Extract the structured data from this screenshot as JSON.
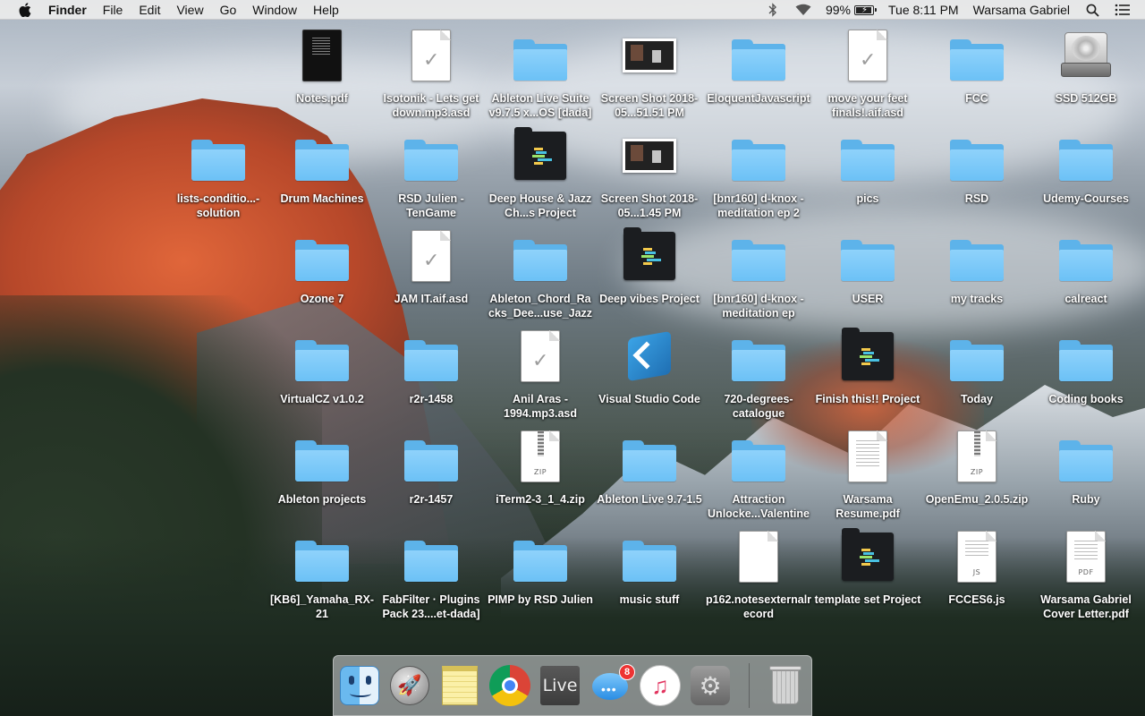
{
  "menubar": {
    "apple_icon": "apple-icon",
    "app_name": "Finder",
    "menus": [
      "File",
      "Edit",
      "View",
      "Go",
      "Window",
      "Help"
    ],
    "status": {
      "bluetooth_icon": "bluetooth-icon",
      "wifi_icon": "wifi-icon",
      "battery_percent": "99%",
      "battery_level": 0.99,
      "clock": "Tue 8:11 PM",
      "user": "Warsama Gabriel",
      "spotlight_icon": "search-icon",
      "notification_icon": "list-icon"
    }
  },
  "desktop": {
    "icons": [
      {
        "label": "Notes.pdf",
        "kind": "pdf-dark"
      },
      {
        "label": "Isotonik - Lets get down.mp3.asd",
        "kind": "doc-check"
      },
      {
        "label": "Ableton Live Suite v9.7.5 x...OS [dada]",
        "kind": "folder"
      },
      {
        "label": "Screen Shot 2018-05...51.51 PM",
        "kind": "screenshot"
      },
      {
        "label": "EloquentJavascript",
        "kind": "folder"
      },
      {
        "label": "move your feet finals!.aif.asd",
        "kind": "doc-check"
      },
      {
        "label": "FCC",
        "kind": "folder"
      },
      {
        "label": "SSD 512GB",
        "kind": "hdd"
      },
      {
        "label": "lists-conditio...-solution",
        "kind": "folder"
      },
      {
        "label": "Drum Machines",
        "kind": "folder"
      },
      {
        "label": "RSD Julien - TenGame",
        "kind": "folder"
      },
      {
        "label": "Deep House & Jazz Ch...s Project",
        "kind": "ableton"
      },
      {
        "label": "Screen Shot 2018-05...1.45 PM",
        "kind": "screenshot"
      },
      {
        "label": "[bnr160] d-knox - meditation ep 2",
        "kind": "folder"
      },
      {
        "label": "pics",
        "kind": "folder"
      },
      {
        "label": "RSD",
        "kind": "folder"
      },
      {
        "label": "Udemy-Courses",
        "kind": "folder"
      },
      {
        "label": "Ozone 7",
        "kind": "folder"
      },
      {
        "label": "JAM IT.aif.asd",
        "kind": "doc-check"
      },
      {
        "label": "Ableton_Chord_Racks_Dee...use_Jazz",
        "kind": "folder"
      },
      {
        "label": "Deep vibes Project",
        "kind": "ableton"
      },
      {
        "label": "[bnr160] d-knox - meditation ep",
        "kind": "folder"
      },
      {
        "label": "USER",
        "kind": "folder"
      },
      {
        "label": "my tracks",
        "kind": "folder"
      },
      {
        "label": "calreact",
        "kind": "folder"
      },
      {
        "label": "VirtualCZ v1.0.2",
        "kind": "folder"
      },
      {
        "label": "r2r-1458",
        "kind": "folder"
      },
      {
        "label": "Anil Aras - 1994.mp3.asd",
        "kind": "doc-check"
      },
      {
        "label": "Visual Studio Code",
        "kind": "vscode"
      },
      {
        "label": "720-degrees-catalogue",
        "kind": "folder"
      },
      {
        "label": "Finish this!! Project",
        "kind": "ableton"
      },
      {
        "label": "Today",
        "kind": "folder"
      },
      {
        "label": "Coding books",
        "kind": "folder"
      },
      {
        "label": "Ableton projects",
        "kind": "folder"
      },
      {
        "label": "r2r-1457",
        "kind": "folder"
      },
      {
        "label": "iTerm2-3_1_4.zip",
        "kind": "zip"
      },
      {
        "label": "Ableton Live 9.7-1.5",
        "kind": "folder"
      },
      {
        "label": "Attraction Unlocke...Valentine",
        "kind": "folder"
      },
      {
        "label": "Warsama Resume.pdf",
        "kind": "doc-lines"
      },
      {
        "label": "OpenEmu_2.0.5.zip",
        "kind": "zip"
      },
      {
        "label": "Ruby",
        "kind": "folder"
      },
      {
        "label": "[KB6]_Yamaha_RX-21",
        "kind": "folder"
      },
      {
        "label": "FabFilter · Plugins Pack 23....et-dada]",
        "kind": "folder"
      },
      {
        "label": "PIMP by RSD Julien",
        "kind": "folder"
      },
      {
        "label": "music stuff",
        "kind": "folder"
      },
      {
        "label": "p162.notesexternalrecord",
        "kind": "doc-blank"
      },
      {
        "label": "template set Project",
        "kind": "ableton"
      },
      {
        "label": "FCCES6.js",
        "kind": "doc-js"
      },
      {
        "label": "Warsama Gabriel Cover Letter.pdf",
        "kind": "doc-pdf"
      }
    ],
    "tags": {
      "zip": "ZIP",
      "js": "JS",
      "pdf": "PDF"
    }
  },
  "dock": {
    "apps": [
      {
        "name": "Finder",
        "icon": "finder-icon",
        "running": true
      },
      {
        "name": "Launchpad",
        "icon": "rocket-icon",
        "running": false
      },
      {
        "name": "Notes",
        "icon": "notes-icon",
        "running": false
      },
      {
        "name": "Google Chrome",
        "icon": "chrome-icon",
        "running": false
      },
      {
        "name": "Ableton Live",
        "icon": "live-icon",
        "label": "Live",
        "running": false
      },
      {
        "name": "Messages",
        "icon": "messages-icon",
        "badge": "8",
        "running": false
      },
      {
        "name": "iTunes",
        "icon": "itunes-icon",
        "running": false
      },
      {
        "name": "System Preferences",
        "icon": "gear-icon",
        "running": false
      },
      {
        "name": "Trash",
        "icon": "trash-icon",
        "running": false
      }
    ]
  }
}
